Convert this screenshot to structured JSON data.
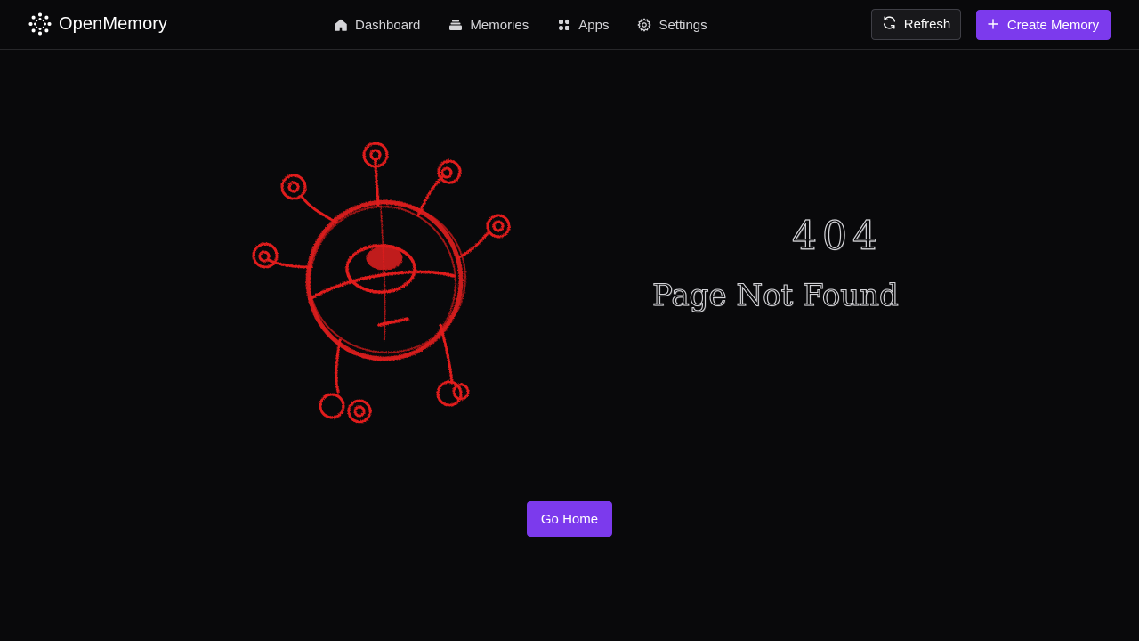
{
  "header": {
    "brand_name": "OpenMemory",
    "brand_icon": "openmemory-logo-icon",
    "nav": [
      {
        "label": "Dashboard",
        "icon": "home-icon"
      },
      {
        "label": "Memories",
        "icon": "layers-icon"
      },
      {
        "label": "Apps",
        "icon": "apps-grid-icon"
      },
      {
        "label": "Settings",
        "icon": "gear-icon"
      }
    ],
    "refresh_label": "Refresh",
    "refresh_icon": "refresh-icon",
    "create_label": "Create Memory",
    "create_icon": "plus-icon"
  },
  "main": {
    "illustration": "red-sketch-monster",
    "error_code": "404",
    "error_message": "Page Not Found",
    "go_home_label": "Go Home"
  },
  "colors": {
    "background": "#09090b",
    "accent": "#7c3aed",
    "monster_red": "#e11d1d",
    "border": "#27272a"
  }
}
